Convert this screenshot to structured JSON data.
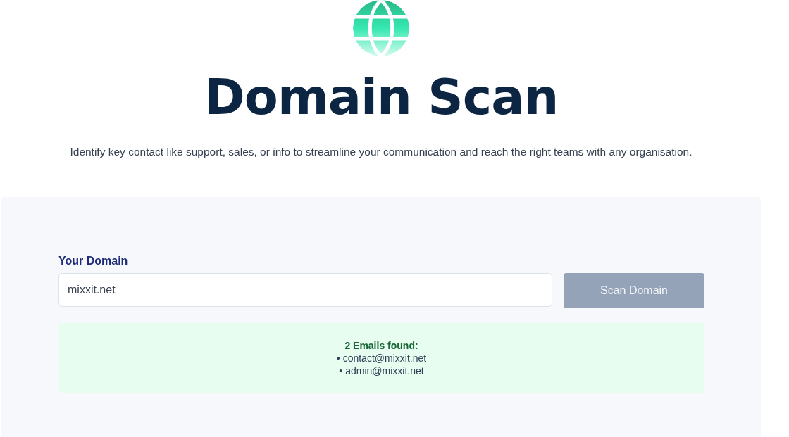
{
  "title": "Domain Scan",
  "subtitle": "Identify key contact like support, sales, or info to streamline your communication and reach the right teams with any organisation.",
  "form": {
    "label": "Your Domain",
    "value": "mixxit.net",
    "button": {
      "label": "Scan Domain",
      "disabled": true
    }
  },
  "result": {
    "heading": "2 Emails found:",
    "emails": [
      "• contact@mixxit.net",
      "• admin@mixxit.net"
    ]
  }
}
